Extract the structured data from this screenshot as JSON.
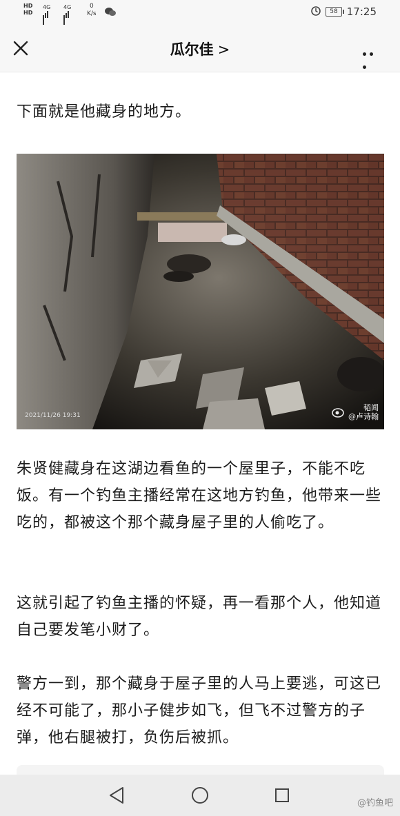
{
  "status_bar": {
    "hd1": "HD",
    "hd2": "HD",
    "sim1": "4G",
    "sim2": "4G",
    "speed_value": "0",
    "speed_unit": "K/s",
    "battery": "58",
    "time": "17:25"
  },
  "header": {
    "title": "瓜尔佳",
    "chevron": ">"
  },
  "article": {
    "paragraphs": [
      "下面就是他藏身的地方。",
      "朱贤健藏身在这湖边看鱼的一个屋里子，不能不吃饭。有一个钓鱼主播经常在这地方钓鱼，他带来一些吃的，都被这个那个藏身屋子里的人偷吃了。",
      "这就引起了钓鱼主播的怀疑，再一看那个人，他知道自己要发笔小财了。",
      "警方一到，那个藏身于屋子里的人马上要逃，可这已经不可能了，那小子健步如飞，但飞不过警方的子弹，他右腿被打，负伤后被抓。"
    ],
    "image": {
      "timestamp": "2021/11/26 19:31",
      "watermark_line1": "韬闻",
      "watermark_line2": "@卢诗翰"
    }
  },
  "bottom_nav": {
    "watermark": "@钓鱼吧"
  },
  "colors": {
    "background": "#ffffff",
    "bar_bg": "#f7f7f7",
    "sysnav_bg": "#ececec"
  }
}
